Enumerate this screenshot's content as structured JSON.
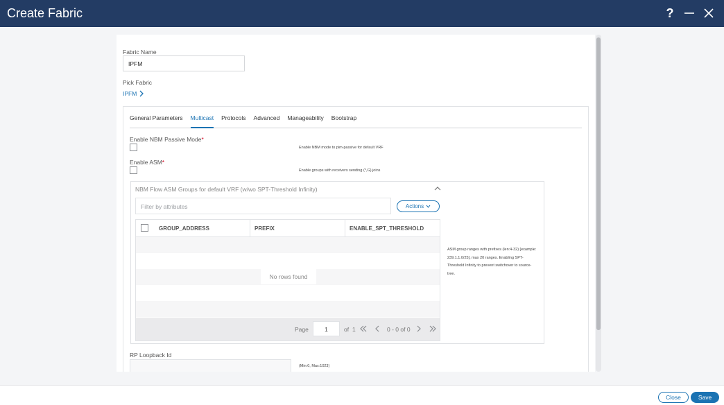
{
  "window": {
    "title": "Create Fabric"
  },
  "form": {
    "fabric_name_label": "Fabric Name",
    "fabric_name_value": "IPFM",
    "pick_fabric_label": "Pick Fabric",
    "pick_fabric_value": "IPFM"
  },
  "tabs": [
    {
      "label": "General Parameters",
      "active": false
    },
    {
      "label": "Multicast",
      "active": true
    },
    {
      "label": "Protocols",
      "active": false
    },
    {
      "label": "Advanced",
      "active": false
    },
    {
      "label": "Manageability",
      "active": false
    },
    {
      "label": "Bootstrap",
      "active": false
    }
  ],
  "multicast": {
    "nbm_passive_label": "Enable NBM Passive Mode",
    "nbm_passive_hint": "Enable NBM mode to pim-passive for default VRF",
    "asm_label": "Enable ASM",
    "asm_hint": "Enable groups with receivers sending (*,G) joins",
    "required_mark": "*"
  },
  "asm_table": {
    "title": "NBM Flow ASM Groups for default VRF (w/wo SPT-Threshold Infinity)",
    "filter_placeholder": "Filter by attributes",
    "actions_label": "Actions",
    "columns": [
      "GROUP_ADDRESS",
      "PREFIX",
      "ENABLE_SPT_THRESHOLD"
    ],
    "empty_text": "No rows found",
    "pager": {
      "page_label": "Page",
      "page_value": "1",
      "of_label": "of",
      "total_pages": "1",
      "range_text": "0 - 0 of 0"
    },
    "hint": "ASM group ranges with prefixes (len:4-32) [example: 239.1.1.0/25], max 20 ranges. Enabling SPT-Threshold Infinity to prevent switchover to source-tree."
  },
  "rp_loopback": {
    "label": "RP Loopback Id",
    "hint": "(Min:0, Max:1023)"
  },
  "footer": {
    "close_label": "Close",
    "save_label": "Save"
  },
  "colors": {
    "titlebar": "#233c64",
    "accent": "#1b73b3",
    "required": "#d0021b"
  }
}
